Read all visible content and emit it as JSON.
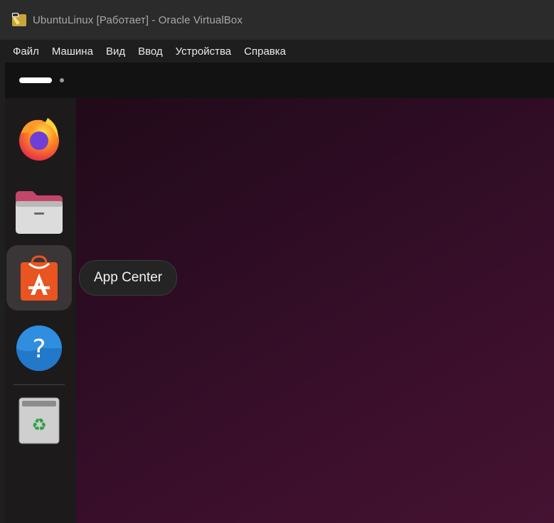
{
  "window": {
    "title": "UbuntuLinux [Работает] - Oracle VirtualBox"
  },
  "menubar": {
    "items": [
      {
        "label": "Файл"
      },
      {
        "label": "Машина"
      },
      {
        "label": "Вид"
      },
      {
        "label": "Ввод"
      },
      {
        "label": "Устройства"
      },
      {
        "label": "Справка"
      }
    ]
  },
  "topbar": {
    "workspaces": 2,
    "active_workspace": 1
  },
  "dock": {
    "items": [
      {
        "name": "Firefox",
        "icon": "firefox-icon"
      },
      {
        "name": "Files",
        "icon": "folder-icon"
      },
      {
        "name": "App Center",
        "icon": "app-center-icon"
      },
      {
        "name": "Help",
        "icon": "help-icon"
      },
      {
        "name": "Trash",
        "icon": "trash-icon"
      }
    ]
  },
  "tooltip": {
    "text": "App Center"
  },
  "colors": {
    "desktop_dark": "#1f0a18",
    "desktop_light": "#451232",
    "app_center_orange": "#e95420",
    "help_blue": "#2f8ee0"
  }
}
